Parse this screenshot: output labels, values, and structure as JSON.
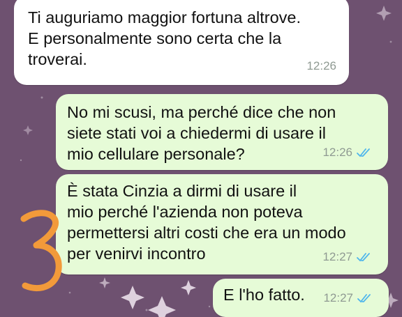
{
  "chat": {
    "messages": [
      {
        "direction": "incoming",
        "lines": [
          "Ti auguriamo maggior fortuna altrove.",
          "E personalmente sono certa che la",
          "troverai."
        ],
        "time": "12:26"
      },
      {
        "direction": "outgoing",
        "lines": [
          "No mi scusi, ma perché dice che non",
          "siete stati voi a chiedermi di usare il",
          "mio cellulare personale?"
        ],
        "time": "12:26",
        "status": "read"
      },
      {
        "direction": "outgoing",
        "lines": [
          "È stata Cinzia a dirmi di usare il",
          "mio perché l'azienda non poteva",
          "permettersi altri costi che era un modo",
          "per venirvi incontro"
        ],
        "time": "12:27",
        "status": "read"
      },
      {
        "direction": "outgoing",
        "lines": [
          "E l'ho fatto."
        ],
        "time": "12:27",
        "status": "read"
      }
    ]
  },
  "colors": {
    "background": "#6e5170",
    "incoming_bubble": "#ffffff",
    "outgoing_bubble": "#e6fbd7",
    "read_ticks": "#4fb6ec",
    "annotation": "#f29a3a"
  },
  "icons": [
    "double-check-icon",
    "sparkle-star-icon"
  ]
}
